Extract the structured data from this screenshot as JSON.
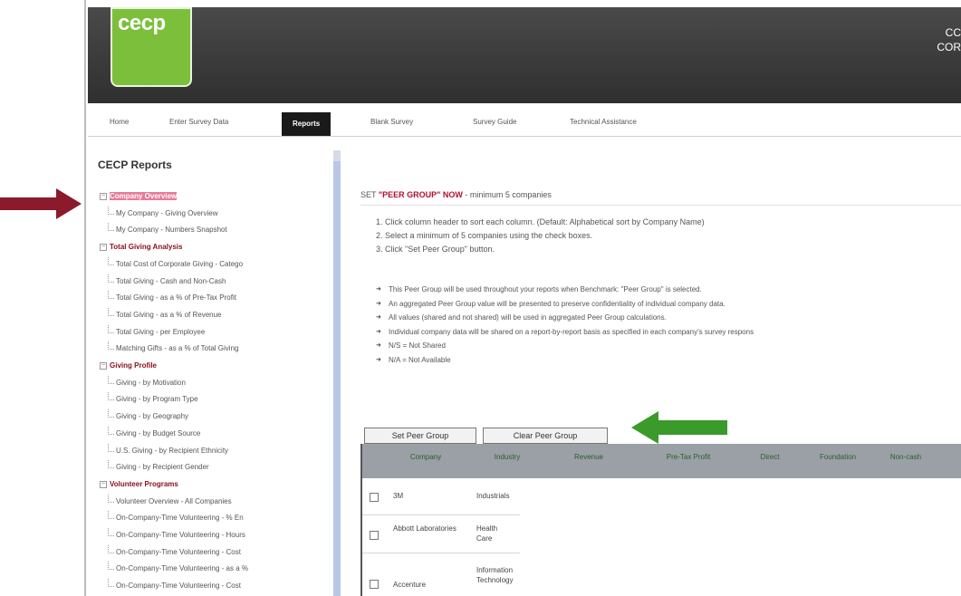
{
  "header": {
    "logo_text": "cecp",
    "right_text_line1": "CC",
    "right_text_line2": "COR"
  },
  "nav": {
    "items": [
      "Home",
      "Enter Survey Data",
      "Reports",
      "Blank Survey",
      "Survey Guide",
      "Technical Assistance"
    ],
    "active": "Reports"
  },
  "sidebar": {
    "title": "CECP Reports",
    "categories": [
      {
        "label": "Company Overview",
        "items": [
          "My Company - Giving Overview",
          "My Company - Numbers Snapshot"
        ]
      },
      {
        "label": "Total Giving Analysis",
        "items": [
          "Total Cost of Corporate Giving - Catego",
          "Total Giving - Cash and Non-Cash",
          "Total Giving - as a % of Pre-Tax Profit",
          "Total Giving - as a % of Revenue",
          "Total Giving - per Employee",
          "Matching Gifts - as a % of Total Giving"
        ]
      },
      {
        "label": "Giving Profile",
        "items": [
          "Giving - by Motivation",
          "Giving - by Program Type",
          "Giving - by Geography",
          "Giving - by Budget Source",
          "U.S. Giving - by Recipient Ethnicity",
          "Giving - by Recipient Gender"
        ]
      },
      {
        "label": "Volunteer Programs",
        "items": [
          "Volunteer Overview - All Companies",
          "On-Company-Time Volunteering - % En",
          "On-Company-Time Volunteering - Hours",
          "On-Company-Time Volunteering - Cost",
          "On-Company-Time Volunteering - as a %",
          "On-Company-Time Volunteering - Cost"
        ]
      }
    ]
  },
  "main": {
    "set_prefix": "SET ",
    "set_highlight": "\"PEER GROUP\" NOW",
    "set_suffix": " - minimum 5 companies",
    "steps": [
      "1.   Click column header to sort each column. (Default: Alphabetical sort by Company Name)",
      "2.   Select a minimum of 5 companies using the check boxes.",
      "3.   Click \"Set Peer Group\" button."
    ],
    "bullets": [
      "This Peer Group will be used throughout your reports when Benchmark: \"Peer Group\" is selected.",
      "An aggregated Peer Group value will be presented to preserve confidentiality of individual company data.",
      "All values (shared and not shared) will be used in aggregated Peer Group calculations.",
      "Individual company data will be shared on a report-by-report basis as specified in each company's survey respons",
      "N/S = Not Shared",
      "N/A = Not Available"
    ],
    "buttons": {
      "set": "Set Peer Group",
      "clear": "Clear Peer Group"
    },
    "table": {
      "headers": [
        "Company",
        "Industry",
        "Revenue",
        "Pre-Tax Profit",
        "Direct",
        "Foundation",
        "Non-cash"
      ],
      "rows": [
        {
          "company": "3M",
          "industry": "Industrials"
        },
        {
          "company": "Abbott Laboratories",
          "industry": "Health Care"
        },
        {
          "company": "Accenture",
          "industry": "Information Technology"
        }
      ]
    }
  },
  "colors": {
    "header_bg": "#3a3a3a",
    "logo_green": "#7bbf3b",
    "category_red": "#8a1020",
    "arrow_red": "#8b1a2b",
    "arrow_green": "#3a9a2a",
    "table_header": "#9aa0a6"
  }
}
